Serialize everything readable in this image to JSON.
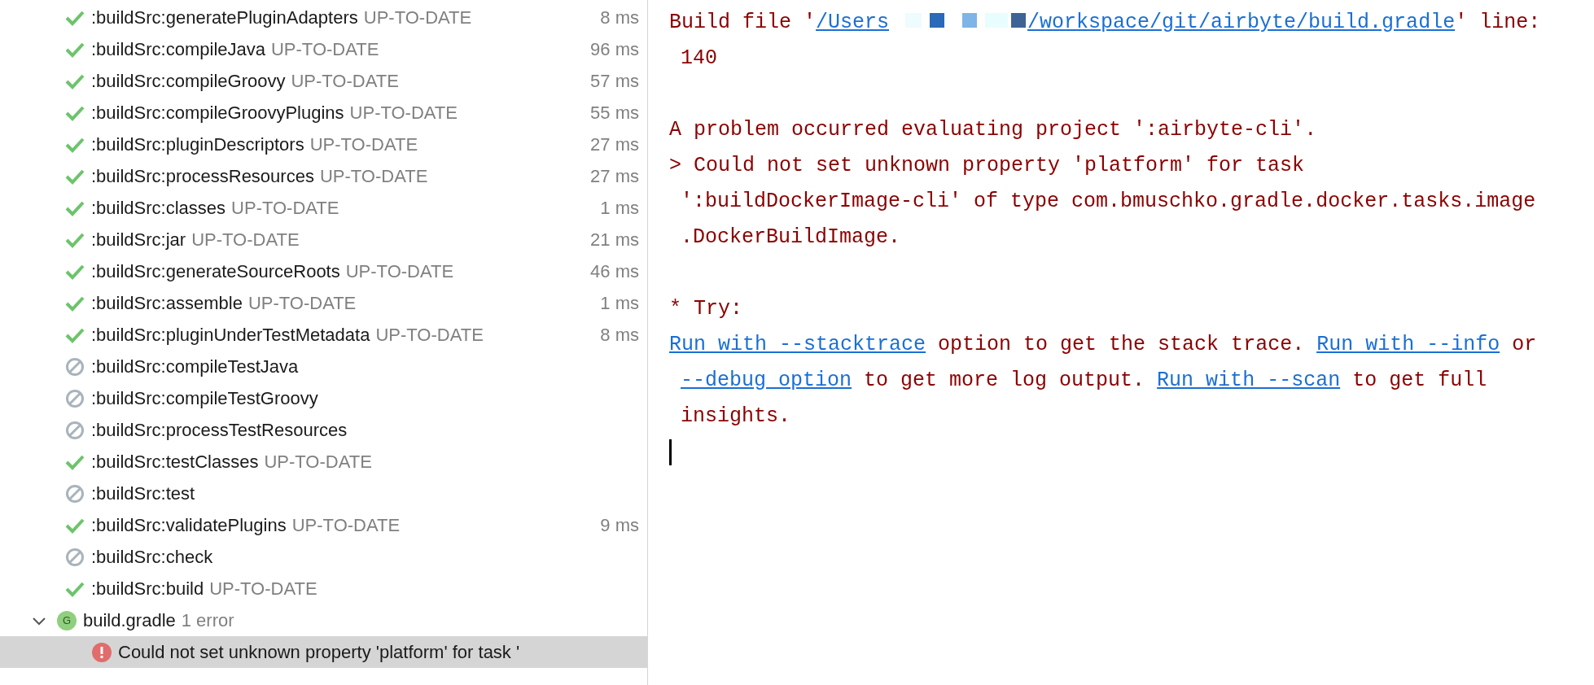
{
  "tasks": [
    {
      "name": ":buildSrc:generatePluginAdapters",
      "status": "UP-TO-DATE",
      "duration": "8 ms",
      "kind": "success"
    },
    {
      "name": ":buildSrc:compileJava",
      "status": "UP-TO-DATE",
      "duration": "96 ms",
      "kind": "success"
    },
    {
      "name": ":buildSrc:compileGroovy",
      "status": "UP-TO-DATE",
      "duration": "57 ms",
      "kind": "success"
    },
    {
      "name": ":buildSrc:compileGroovyPlugins",
      "status": "UP-TO-DATE",
      "duration": "55 ms",
      "kind": "success"
    },
    {
      "name": ":buildSrc:pluginDescriptors",
      "status": "UP-TO-DATE",
      "duration": "27 ms",
      "kind": "success"
    },
    {
      "name": ":buildSrc:processResources",
      "status": "UP-TO-DATE",
      "duration": "27 ms",
      "kind": "success"
    },
    {
      "name": ":buildSrc:classes",
      "status": "UP-TO-DATE",
      "duration": "1 ms",
      "kind": "success"
    },
    {
      "name": ":buildSrc:jar",
      "status": "UP-TO-DATE",
      "duration": "21 ms",
      "kind": "success"
    },
    {
      "name": ":buildSrc:generateSourceRoots",
      "status": "UP-TO-DATE",
      "duration": "46 ms",
      "kind": "success"
    },
    {
      "name": ":buildSrc:assemble",
      "status": "UP-TO-DATE",
      "duration": "1 ms",
      "kind": "success"
    },
    {
      "name": ":buildSrc:pluginUnderTestMetadata",
      "status": "UP-TO-DATE",
      "duration": "8 ms",
      "kind": "success"
    },
    {
      "name": ":buildSrc:compileTestJava",
      "kind": "skipped"
    },
    {
      "name": ":buildSrc:compileTestGroovy",
      "kind": "skipped"
    },
    {
      "name": ":buildSrc:processTestResources",
      "kind": "skipped"
    },
    {
      "name": ":buildSrc:testClasses",
      "status": "UP-TO-DATE",
      "kind": "success"
    },
    {
      "name": ":buildSrc:test",
      "kind": "skipped"
    },
    {
      "name": ":buildSrc:validatePlugins",
      "status": "UP-TO-DATE",
      "duration": "9 ms",
      "kind": "success"
    },
    {
      "name": ":buildSrc:check",
      "kind": "skipped"
    },
    {
      "name": ":buildSrc:build",
      "status": "UP-TO-DATE",
      "kind": "success"
    }
  ],
  "file": {
    "badge": "G",
    "name": "build.gradle",
    "summary": "1 error",
    "expanded": true,
    "children": [
      {
        "kind": "error",
        "text": "Could not set unknown property 'platform' for task '",
        "selected": true
      }
    ]
  },
  "console": [
    {
      "kind": "line",
      "parts": [
        {
          "text": "Build file '"
        },
        {
          "text": "/Users",
          "link": true
        },
        {
          "kind": "redacted"
        },
        {
          "text": "/workspace/git/airbyte/build.gradle",
          "link": true
        },
        {
          "text": "' line:"
        }
      ]
    },
    {
      "kind": "wrap",
      "parts": [
        {
          "text": "140"
        }
      ]
    },
    {
      "kind": "blank"
    },
    {
      "kind": "line",
      "parts": [
        {
          "text": "A problem occurred evaluating project ':airbyte-cli'."
        }
      ]
    },
    {
      "kind": "line",
      "parts": [
        {
          "text": "> Could not set unknown property 'platform' for task"
        }
      ]
    },
    {
      "kind": "wrap",
      "parts": [
        {
          "text": "':buildDockerImage-cli' of type com.bmuschko.gradle.docker.tasks.image"
        }
      ]
    },
    {
      "kind": "wrap",
      "parts": [
        {
          "text": ".DockerBuildImage."
        }
      ]
    },
    {
      "kind": "blank"
    },
    {
      "kind": "line",
      "parts": [
        {
          "text": "* Try:"
        }
      ]
    },
    {
      "kind": "line",
      "parts": [
        {
          "text": "Run with --stacktrace",
          "link": true
        },
        {
          "text": " option to get the stack trace. "
        },
        {
          "text": "Run with --info",
          "link": true
        },
        {
          "text": " or"
        }
      ]
    },
    {
      "kind": "wrap",
      "parts": [
        {
          "text": "--debug option",
          "link": true
        },
        {
          "text": " to get more log output. "
        },
        {
          "text": "Run with --scan",
          "link": true
        },
        {
          "text": " to get full"
        }
      ]
    },
    {
      "kind": "wrap",
      "parts": [
        {
          "text": "insights."
        }
      ]
    }
  ],
  "cursor": true
}
